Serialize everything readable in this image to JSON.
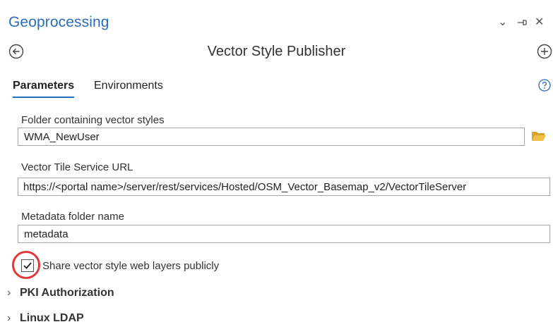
{
  "pane": {
    "title": "Geoprocessing",
    "controls": {
      "menu_glyph": "⌄",
      "pin_glyph": "⊣",
      "close_glyph": "✕"
    }
  },
  "tool": {
    "name": "Vector Style Publisher"
  },
  "tabs": [
    {
      "label": "Parameters",
      "active": true
    },
    {
      "label": "Environments",
      "active": false
    }
  ],
  "parameters": {
    "folder": {
      "label": "Folder containing vector styles",
      "value": "WMA_NewUser"
    },
    "service_url": {
      "label": "Vector Tile Service URL",
      "value": "https://<portal name>/server/rest/services/Hosted/OSM_Vector_Basemap_v2/VectorTileServer"
    },
    "metadata": {
      "label": "Metadata folder name",
      "value": "metadata"
    },
    "share_publicly": {
      "label": "Share vector style web layers publicly",
      "checked": true
    }
  },
  "groups": [
    {
      "label": "PKI Authorization",
      "expanded": false
    },
    {
      "label": "Linux LDAP",
      "expanded": false
    }
  ],
  "icons": {
    "back": "back-arrow-circle-icon",
    "add": "add-circle-icon",
    "help": "help-circle-icon",
    "browse": "folder-open-icon",
    "check": "checkmark-icon"
  },
  "colors": {
    "accent": "#2a6ebb",
    "highlight": "#e0393e",
    "folder": "#e8b330"
  }
}
